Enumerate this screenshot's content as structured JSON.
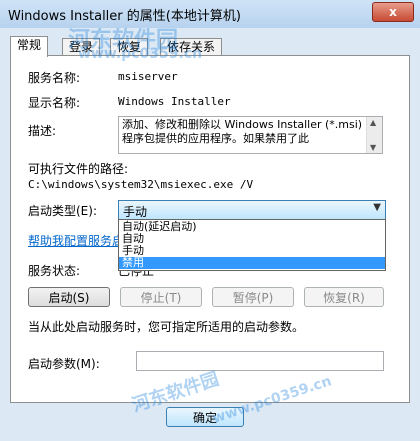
{
  "window": {
    "title": "Windows Installer 的属性(本地计算机)",
    "close_label": "x"
  },
  "tabs": [
    "常规",
    "登录",
    "恢复",
    "依存关系"
  ],
  "service_name_label": "服务名称:",
  "service_name_value": "msiserver",
  "display_name_label": "显示名称:",
  "display_name_value": "Windows Installer",
  "description_label": "描述:",
  "description_value": "添加、修改和删除以 Windows Installer (*.msi)程序包提供的应用程序。如果禁用了此",
  "exe_path_label": "可执行文件的路径:",
  "exe_path_value": "C:\\windows\\system32\\msiexec.exe /V",
  "startup_type_label": "启动类型(E):",
  "startup_type_value": "手动",
  "startup_type_options": [
    "自动(延迟启动)",
    "自动",
    "手动",
    "禁用"
  ],
  "help_link": "帮助我配置服务启",
  "service_status_label": "服务状态:",
  "service_status_value": "已停止",
  "buttons": {
    "start": "启动(S)",
    "stop": "停止(T)",
    "pause": "暂停(P)",
    "resume": "恢复(R)"
  },
  "start_hint": "当从此处启动服务时，您可指定所适用的启动参数。",
  "start_params_label": "启动参数(M):",
  "start_params_value": "",
  "ok_button": "确定",
  "watermark": {
    "site": "河东软件园",
    "url": "www.pc0359.cn"
  }
}
